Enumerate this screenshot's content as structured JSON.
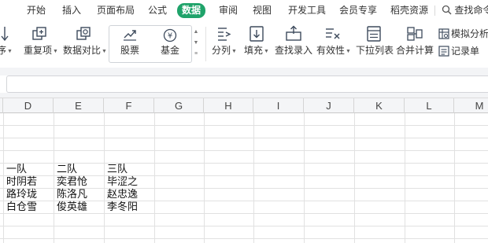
{
  "menu": {
    "tabs": [
      "开始",
      "插入",
      "页面布局",
      "公式",
      "数据",
      "审阅",
      "视图",
      "开发工具",
      "会员专享",
      "稻壳资源"
    ],
    "active": "数据",
    "search_label": "查找命令"
  },
  "ribbon": {
    "partial_left_label": "序",
    "duplicates_label": "重复项",
    "compare_label": "数据对比",
    "stock_label": "股票",
    "fund_label": "基金",
    "split_label": "分列",
    "fill_label": "填充",
    "lookup_label": "查找录入",
    "validity_label": "有效性",
    "dropdown_label": "下拉列表",
    "merge_calc_label": "合并计算",
    "simulate_label": "模拟分析",
    "record_label": "记录单"
  },
  "colors": {
    "accent": "#1fa36a",
    "icon": "#3d4a5c",
    "grid_line": "#e1e1e1",
    "header_bg": "#f4f5f7"
  },
  "sheet": {
    "columns": [
      "D",
      "E",
      "F",
      "G",
      "H",
      "I",
      "J",
      "K",
      "L",
      "M"
    ],
    "rows": [
      [
        "一队",
        "二队",
        "三队"
      ],
      [
        "时阴若",
        "奕君怆",
        "毕涩之"
      ],
      [
        "路玲珑",
        "陈洛凡",
        "赵忠逸"
      ],
      [
        "白仓雪",
        "俊英雄",
        "李冬阳"
      ]
    ]
  }
}
